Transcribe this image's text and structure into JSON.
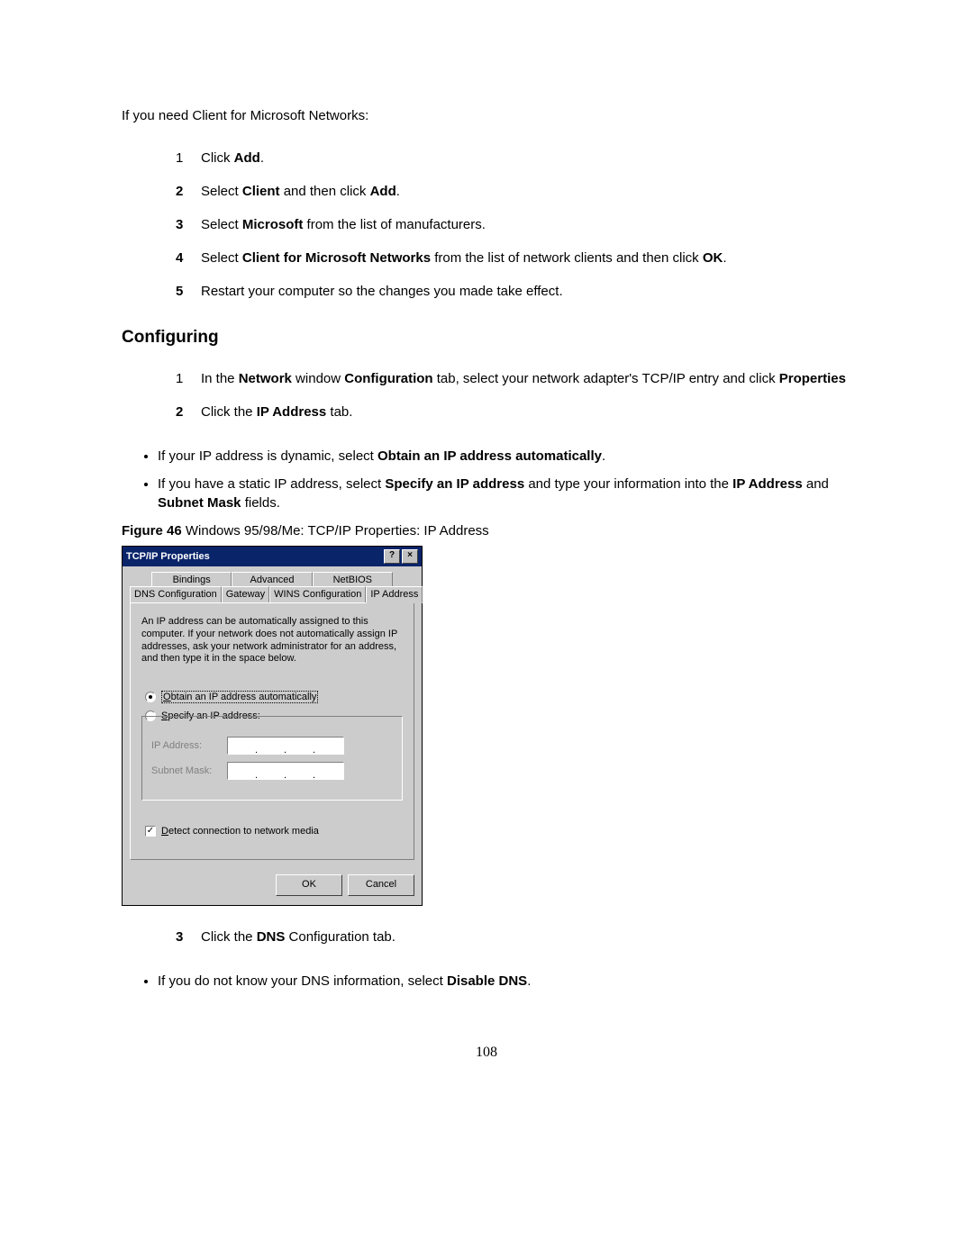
{
  "intro": "If you need Client for Microsoft Networks:",
  "steps1": [
    {
      "n": "1",
      "parts": [
        "Click ",
        "Add",
        "."
      ]
    },
    {
      "n": "2",
      "parts": [
        "Select ",
        "Client",
        " and then click ",
        "Add",
        "."
      ]
    },
    {
      "n": "3",
      "parts": [
        "Select ",
        "Microsoft",
        " from the list of manufacturers."
      ]
    },
    {
      "n": "4",
      "parts": [
        "Select ",
        "Client for Microsoft Networks",
        " from the list of network clients and then click ",
        "OK",
        "."
      ]
    },
    {
      "n": "5",
      "parts": [
        "Restart your computer so the changes you made take effect."
      ]
    }
  ],
  "section_heading": "Configuring",
  "steps2a": [
    {
      "n": "1",
      "parts": [
        "In the ",
        "Network",
        " window ",
        "Configuration",
        " tab, select your network adapter's TCP/IP entry and click ",
        "Properties"
      ]
    },
    {
      "n": "2",
      "parts": [
        "Click the ",
        "IP Address",
        " tab."
      ]
    }
  ],
  "bullets_a": [
    {
      "parts": [
        "If your IP address is dynamic, select ",
        "Obtain an IP address automatically",
        "."
      ]
    },
    {
      "parts": [
        "If you have a static IP address, select ",
        "Specify an IP address",
        " and type your information into the ",
        "IP Address",
        " and ",
        "Subnet Mask",
        " fields."
      ]
    }
  ],
  "figure": {
    "label": "Figure 46",
    "caption": "  Windows 95/98/Me: TCP/IP Properties: IP Address"
  },
  "dialog": {
    "title": "TCP/IP Properties",
    "help": "?",
    "close": "×",
    "tabs_row1": [
      "Bindings",
      "Advanced",
      "NetBIOS"
    ],
    "tabs_row2": [
      "DNS Configuration",
      "Gateway",
      "WINS Configuration",
      "IP Address"
    ],
    "desc": "An IP address can be automatically assigned to this computer. If your network does not automatically assign IP addresses, ask your network administrator for an address, and then type it in the space below.",
    "radio_auto": "Obtain an IP address automatically",
    "radio_specify": "Specify an IP address:",
    "ip_label": "IP Address:",
    "mask_label": "Subnet Mask:",
    "detect": "Detect connection to network media",
    "ok": "OK",
    "cancel": "Cancel"
  },
  "steps2b": [
    {
      "n": "3",
      "parts": [
        "Click the ",
        "DNS",
        " Configuration tab."
      ]
    }
  ],
  "bullets_b": [
    {
      "parts": [
        "If you do not know your DNS information, select ",
        "Disable DNS",
        "."
      ]
    }
  ],
  "page_num": "108"
}
